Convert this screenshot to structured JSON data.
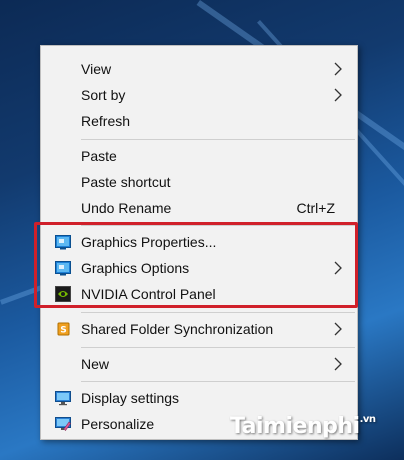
{
  "menu": {
    "view": "View",
    "sort_by": "Sort by",
    "refresh": "Refresh",
    "paste": "Paste",
    "paste_shortcut": "Paste shortcut",
    "undo_rename": "Undo Rename",
    "undo_rename_shortcut": "Ctrl+Z",
    "graphics_properties": "Graphics Properties...",
    "graphics_options": "Graphics Options",
    "nvidia_control_panel": "NVIDIA Control Panel",
    "shared_folder_sync": "Shared Folder Synchronization",
    "new": "New",
    "display_settings": "Display settings",
    "personalize": "Personalize"
  },
  "icons": {
    "graphics_properties": "intel-graphics-icon",
    "graphics_options": "intel-graphics-icon",
    "nvidia_control_panel": "nvidia-icon",
    "shared_folder_sync": "sync-folder-icon",
    "display_settings": "monitor-icon",
    "personalize": "personalize-icon"
  },
  "colors": {
    "highlight_border": "#d0202a",
    "menu_background": "#f2f2f2"
  },
  "watermark": {
    "text": "Taimienphi",
    "suffix": ".vn"
  }
}
